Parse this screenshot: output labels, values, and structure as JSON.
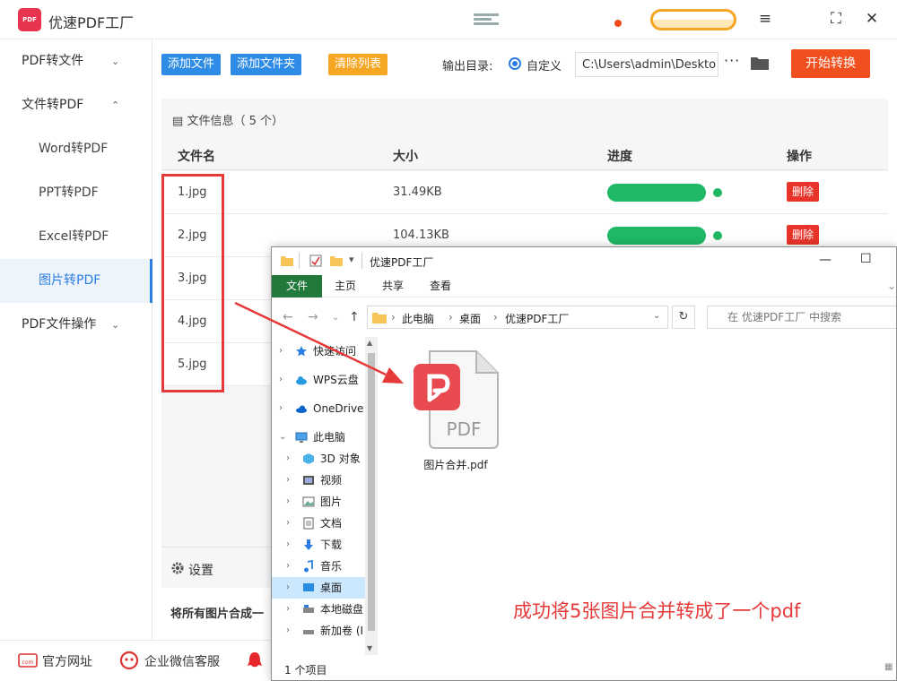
{
  "app": {
    "title": "优速PDF工厂",
    "logo_text": "PDF"
  },
  "sidebar": {
    "items": [
      {
        "label": "PDF转文件",
        "caret": "⌄"
      },
      {
        "label": "文件转PDF",
        "caret": "⌃"
      },
      {
        "label": "Word转PDF"
      },
      {
        "label": "PPT转PDF"
      },
      {
        "label": "Excel转PDF"
      },
      {
        "label": "图片转PDF"
      },
      {
        "label": "PDF文件操作",
        "caret": "⌄"
      }
    ]
  },
  "toolbar": {
    "add_file": "添加文件",
    "add_folder": "添加文件夹",
    "clear_list": "清除列表",
    "output_label": "输出目录:",
    "radio_label": "自定义",
    "output_path": "C:\\Users\\admin\\Deskto",
    "more": "···",
    "start": "开始转换"
  },
  "file_panel": {
    "title": "文件信息（ 5 个）",
    "headers": {
      "name": "文件名",
      "size": "大小",
      "progress": "进度",
      "action": "操作"
    },
    "rows": [
      {
        "name": "1.jpg",
        "size": "31.49KB",
        "progress": 1.0,
        "delete": "删除"
      },
      {
        "name": "2.jpg",
        "size": "104.13KB",
        "progress": 1.0,
        "delete": "删除"
      },
      {
        "name": "3.jpg"
      },
      {
        "name": "4.jpg"
      },
      {
        "name": "5.jpg"
      }
    ]
  },
  "settings": {
    "label": "设置",
    "merge_label": "将所有图片合成一"
  },
  "footer": {
    "website": "官方网址",
    "wechat": "企业微信客服",
    "website_icon": "com"
  },
  "explorer": {
    "title": "优速PDF工厂",
    "tabs": [
      "文件",
      "主页",
      "共享",
      "查看"
    ],
    "breadcrumb": [
      "此电脑",
      "桌面",
      "优速PDF工厂"
    ],
    "search_placeholder": "在 优速PDF工厂 中搜索",
    "nav": [
      {
        "label": "快速访问",
        "caret": "›"
      },
      {
        "label": "WPS云盘",
        "caret": "›"
      },
      {
        "label": "OneDrive",
        "caret": "›"
      },
      {
        "label": "此电脑",
        "caret": "⌄"
      },
      {
        "label": "3D 对象",
        "caret": "›"
      },
      {
        "label": "视频",
        "caret": "›"
      },
      {
        "label": "图片",
        "caret": "›"
      },
      {
        "label": "文档",
        "caret": "›"
      },
      {
        "label": "下载",
        "caret": "›"
      },
      {
        "label": "音乐",
        "caret": "›"
      },
      {
        "label": "桌面",
        "caret": "›"
      },
      {
        "label": "本地磁盘",
        "caret": "›"
      },
      {
        "label": "新加卷 (I",
        "caret": "›"
      }
    ],
    "file": {
      "name": "图片合并.pdf",
      "badge": "PDF"
    },
    "status": "1 个项目"
  },
  "annotation": "成功将5张图片合并转成了一个pdf",
  "colors": {
    "accent_blue": "#2a7de1",
    "start_red": "#f04f1e",
    "progress_green": "#1fb866",
    "annotation_red": "#e63a3a",
    "file_tab_green": "#21793b"
  }
}
